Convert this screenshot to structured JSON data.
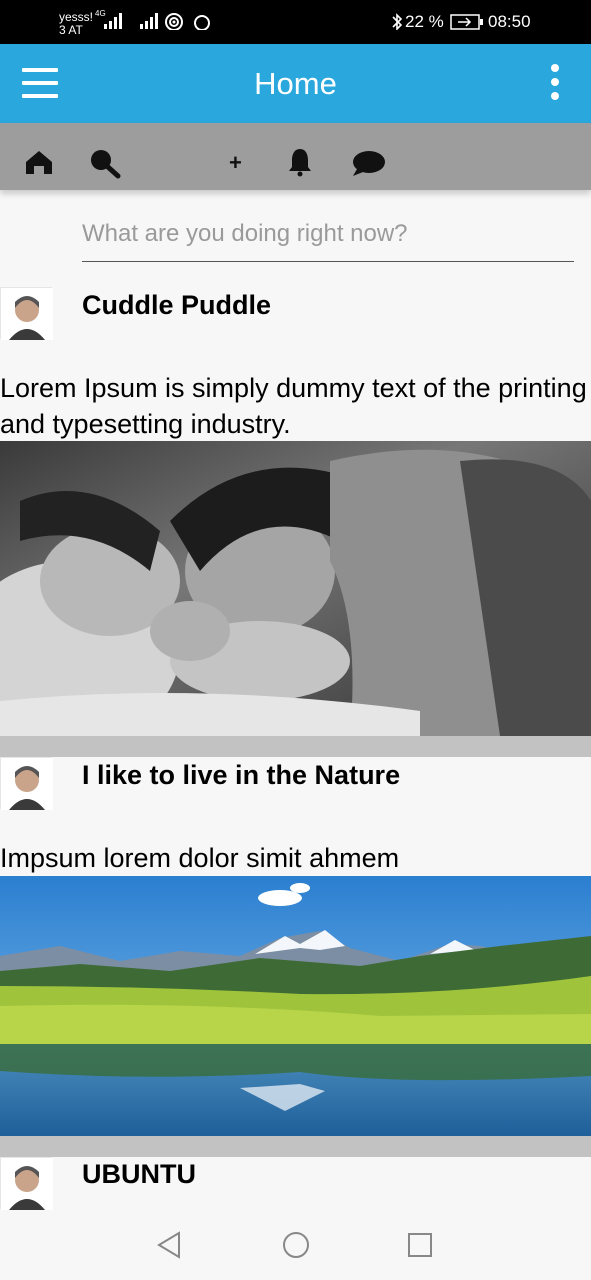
{
  "status_bar": {
    "carrier_line1": "yesss!",
    "carrier_line2": "3 AT",
    "network": "4G",
    "battery": "22 %",
    "time": "08:50"
  },
  "app_bar": {
    "title": "Home"
  },
  "toolbar": {
    "add_label": "+",
    "icons": [
      "home-icon",
      "search-icon",
      "add-icon",
      "bell-icon",
      "chat-icon"
    ]
  },
  "composer": {
    "placeholder": "What are you doing right now?",
    "value": ""
  },
  "posts": [
    {
      "title": "Cuddle Puddle",
      "text": "Lorem Ipsum is simply dummy text of the printing and typesetting industry.",
      "image": "couple-photo"
    },
    {
      "title": "I like to live in the Nature",
      "text": "Impsum lorem dolor simit ahmem",
      "image": "mountain-lake-photo"
    },
    {
      "title": "UBUNTU",
      "text": "",
      "image": ""
    }
  ],
  "colors": {
    "app_bar": "#2aa8de",
    "toolbar": "#9d9d9d",
    "separator": "#c2c2c2",
    "background": "#f7f7f7"
  }
}
